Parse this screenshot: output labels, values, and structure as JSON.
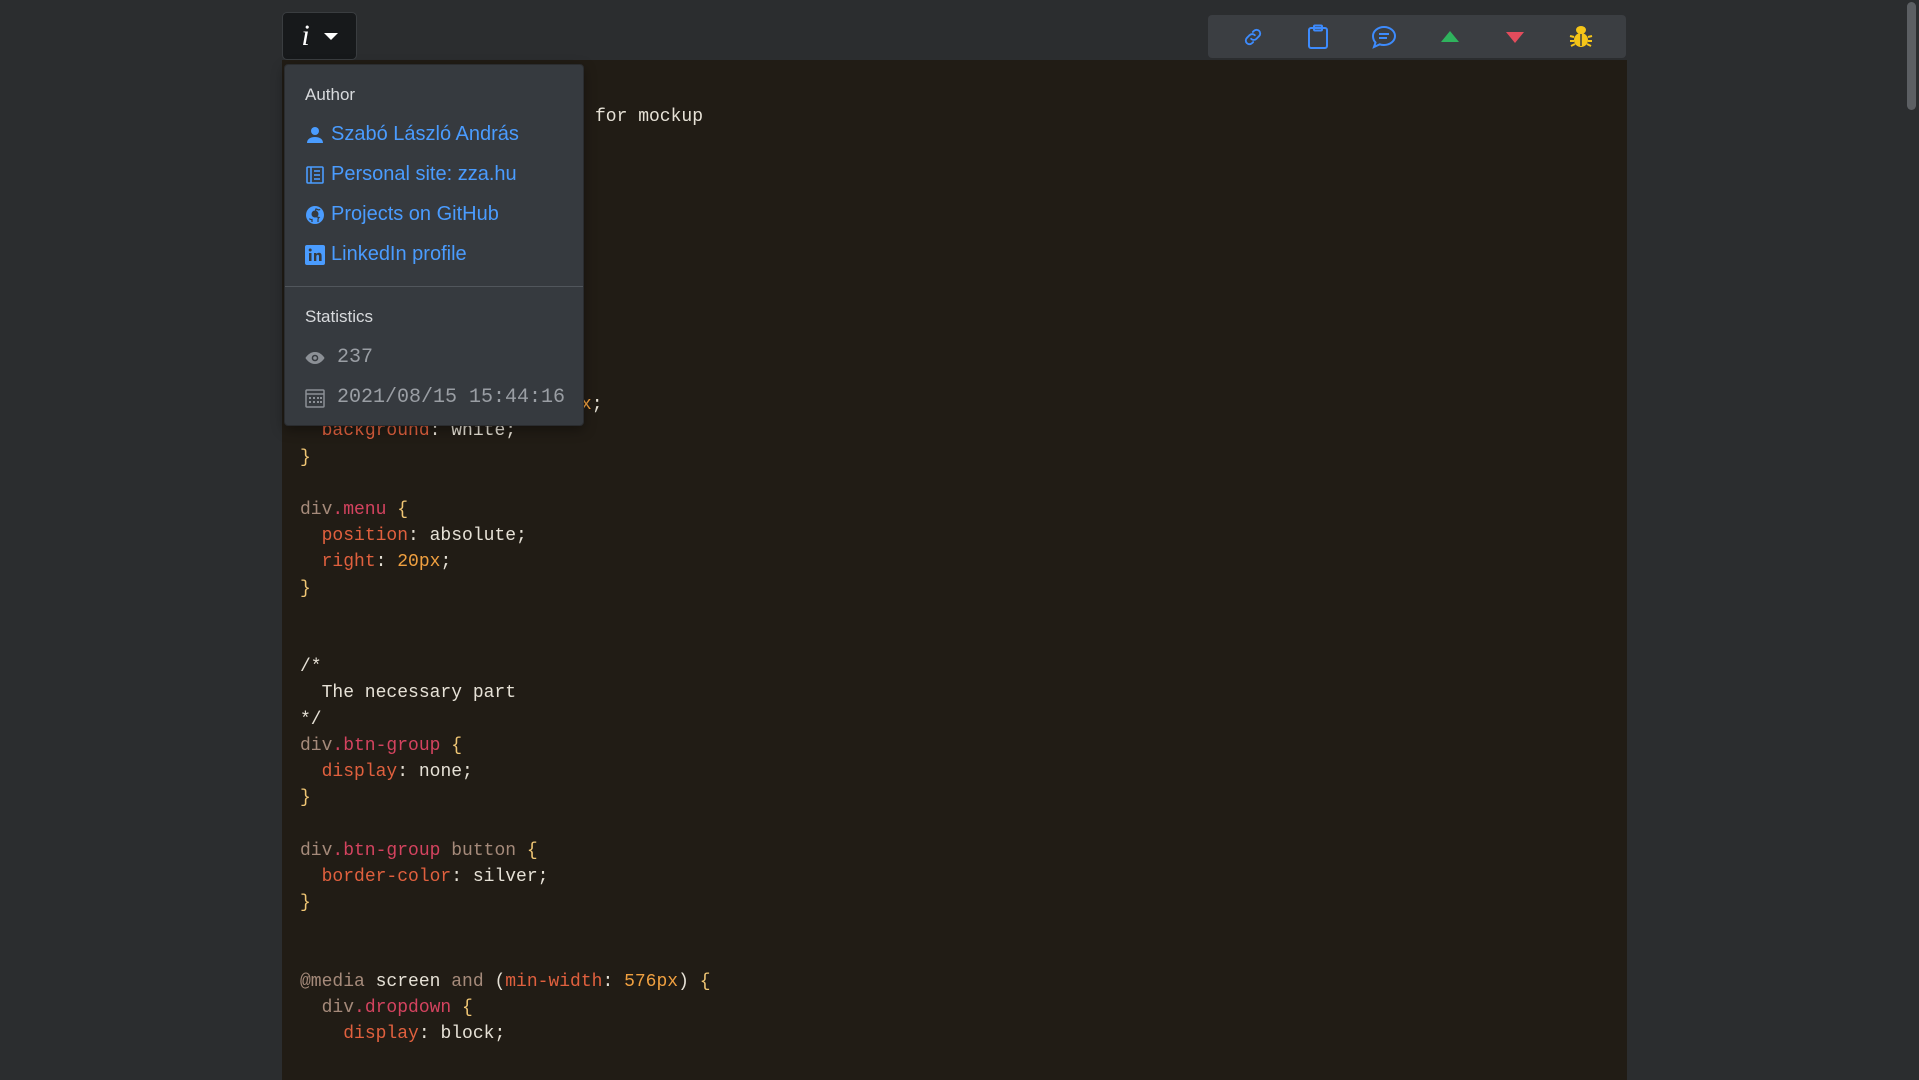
{
  "info_button": {
    "glyph": "i"
  },
  "toolbar": {
    "buttons": [
      {
        "icon": "link-icon",
        "color": "#3d8bfd"
      },
      {
        "icon": "clipboard-icon",
        "color": "#3d8bfd"
      },
      {
        "icon": "comment-icon",
        "color": "#3d8bfd"
      },
      {
        "icon": "triangle-up-icon",
        "color": "#2fb35d"
      },
      {
        "icon": "triangle-down-icon",
        "color": "#e34c5c"
      },
      {
        "icon": "bug-icon",
        "color": "#f5c518"
      }
    ]
  },
  "dropdown": {
    "author_header": "Author",
    "author_items": [
      {
        "icon": "person-icon",
        "label": "Szabó László András"
      },
      {
        "icon": "journal-icon",
        "label": "Personal site: zza.hu"
      },
      {
        "icon": "github-icon",
        "label": "Projects on GitHub"
      },
      {
        "icon": "linkedin-icon",
        "label": "LinkedIn profile"
      }
    ],
    "stats_header": "Statistics",
    "views": "237",
    "date": "2021/08/15 15:44:16"
  },
  "code": {
    "line_fragment": "for mockup"
  }
}
